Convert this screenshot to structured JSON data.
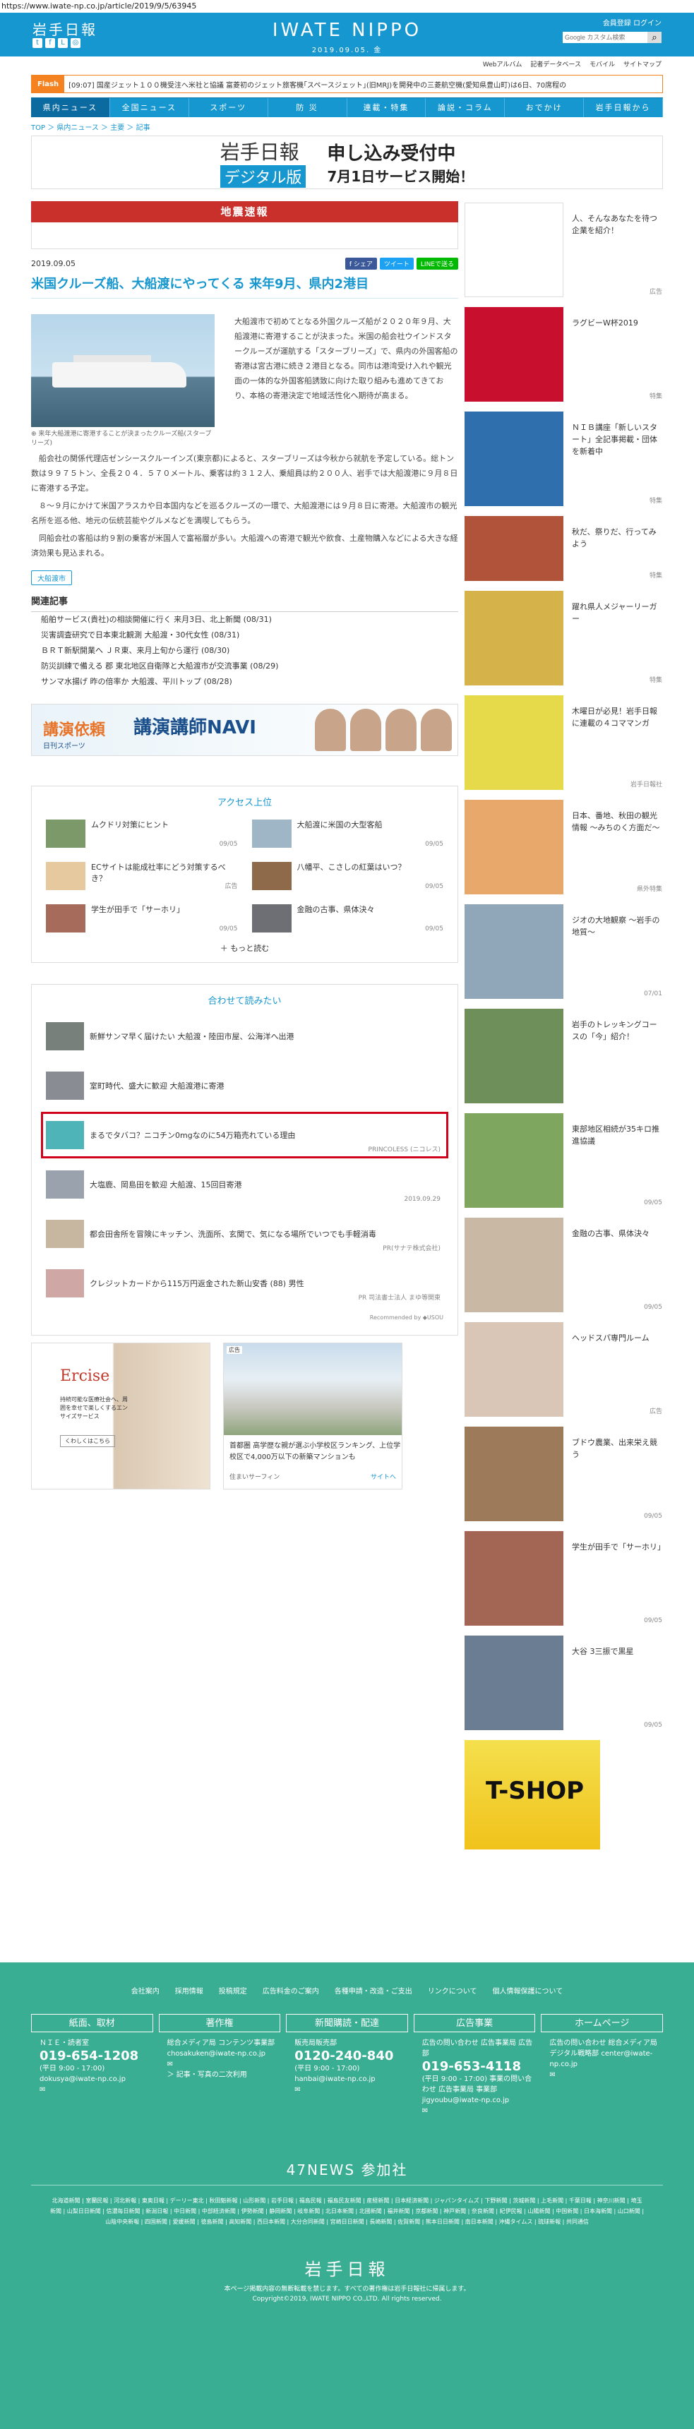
{
  "browser": {
    "url": "https://www.iwate-np.co.jp/article/2019/9/5/63945"
  },
  "header": {
    "logo_small": "岩手日報",
    "brand": "IWATE NIPPO",
    "date": "2019.09.05. 金",
    "login": "会員登録  ログイン",
    "search_placeholder": "Google カスタム検索",
    "subnav": [
      "Webアルバム",
      "記者データベース",
      "モバイル",
      "サイトマップ"
    ]
  },
  "flash": {
    "tag": "Flash",
    "text": "[09:07] 国産ジェット１００機受注へ米社と協議  富菱初のジェット旅客機｢スペースジェット｣(旧MRJ)を開発中の三菱航空機(愛知県豊山町)は6日、70席程の"
  },
  "nav": [
    "県内ニュース",
    "全国ニュース",
    "スポーツ",
    "防 災",
    "連載・特集",
    "論説・コラム",
    "おでかけ",
    "岩手日報から"
  ],
  "breadcrumb": "TOP ＞ 県内ニュース ＞ 主要 ＞ 記事",
  "banner": {
    "line1": "岩手日報",
    "line2": "デジタル版",
    "line3": "申し込み受付中",
    "line4": "7月1日サービス開始！"
  },
  "quake": {
    "title": "地震速報"
  },
  "article": {
    "date": "2019.09.05",
    "share": [
      "f シェア",
      "ツイート",
      "LINEで送る"
    ],
    "title": "米国クルーズ船、大船渡にやってくる  来年9月、県内2港目",
    "caption": "来年大船渡港に寄港することが決まったクルーズ船(スターブリーズ)",
    "p1": "大船渡市で初めてとなる外国クルーズ船が２０２０年９月、大船渡港に寄港することが決まった。米国の船会社ウインドスタークルーズが運航する「スターブリーズ」で、県内の外国客船の寄港は宮古港に続き２港目となる。同市は港湾受け入れや観光面の一体的な外国客船誘致に向けた取り組みも進めてきており、本格の寄港決定で地域活性化へ期待が高まる。",
    "p2": "船会社の関係代理店ゼンシースクルーインズ(東京都)によると、スターブリーズは今秋から就航を予定している。総トン数は９９７５トン、全長２０４．５７０メートル、乗客は約３１２人、乗組員は約２００人、岩手では大船渡港に９月８日に寄港する予定。",
    "p3": "８～９月にかけて米国アラスカや日本国内などを巡るクルーズの一環で、大船渡港には９月８日に寄港。大船渡市の観光名所を巡る他、地元の伝統芸能やグルメなどを満喫してもらう。",
    "p4": "同船会社の客船は約９割の乗客が米国人で富裕層が多い。大船渡への寄港で観光や飲食、土産物購入などによる大きな経済効果も見込まれる。",
    "tag": "大船渡市"
  },
  "related": {
    "title": "関連記事",
    "items": [
      "船舶サービス(貴社)の相談開催に行く  来月3日、北上新聞 (08/31)",
      "災害調査研究で日本東北観測  大船渡・30代女性 (08/31)",
      "ＢＲＴ新駅開業へ  ＪＲ東、来月上旬から運行 (08/30)",
      "防災訓練で備える  郡  東北地区自衛隊と大船渡市が交流事業 (08/29)",
      "サンマ水揚げ 昨の倍率か  大船渡、平川トップ (08/28)"
    ]
  },
  "ad2": {
    "t1": "講演依頼",
    "t2": "講演講師NAVI",
    "sub": "日刊スポーツ",
    "btn": "詳しくはこちら ▶"
  },
  "access": {
    "title": "アクセス上位",
    "items": [
      {
        "text": "ムクドリ対策にヒント",
        "date": "09/05"
      },
      {
        "text": "大船渡に米国の大型客船",
        "date": "09/05"
      },
      {
        "text": "ECサイトは能成社率にどう対策するべき？",
        "date": "広告"
      },
      {
        "text": "八幡平、こさしの紅葉はいつ？",
        "date": "09/05"
      },
      {
        "text": "学生が田手で「サーホリ」",
        "date": "09/05"
      },
      {
        "text": "金融の古事、県体決々",
        "date": "09/05"
      }
    ],
    "more": "＋ もっと読む"
  },
  "recommend": {
    "title": "合わせて読みたい",
    "items": [
      {
        "text": "新鮮サンマ早く届けたい  大船渡・陸田市屋、公海洋へ出港",
        "src": ""
      },
      {
        "text": "室町時代、盛大に歓迎  大船渡港に寄港",
        "src": ""
      },
      {
        "text": "まるでタバコ？ニコチン0mgなのに54万箱売れている理由",
        "src": "PRINCOLESS (ニコレス)"
      },
      {
        "text": "大塩鹿、岡島田を歓迎  大船渡、15回目寄港",
        "src": "2019.09.29"
      },
      {
        "text": "都会田舎所を冒険にキッチン、洗面所、玄関で、気になる場所でいつでも手軽消毒",
        "src": "PR(サナテ株式会社)"
      },
      {
        "text": "クレジットカードから115万円返金された新山安香 (88) 男性",
        "src": "PR 司法書士法人 まゆ等関東"
      }
    ],
    "powered": "Recommended by ◆USOU"
  },
  "ads3": {
    "a1_title": "Ercise",
    "a1_sub": "持続可能な医療社会へ、周囲を幸せで楽しくするエンサイズサービス",
    "a1_btn": "くわしくはこちら",
    "a2_label": "広告",
    "a2_title": "首都圏 高学歴な親が選ぶ小学校区ランキング、上位学校区で4,000万以下の新築マンションも",
    "a2_src": "住まいサーフィン",
    "a2_url": "サイトへ"
  },
  "side": [
    {
      "text": "人、そんなあなたを待つ企業を紹介！",
      "date": "広告"
    },
    {
      "text": "ラグビーW杯2019",
      "date": "特集"
    },
    {
      "text": "ＮＩＢ講座「新しいスタート」全記事掲載・団体を新着中",
      "date": "特集"
    },
    {
      "text": "秋だ、祭りだ、行ってみよう",
      "date": "特集"
    },
    {
      "text": "躍れ県人メジャーリーガー",
      "date": "特集"
    },
    {
      "text": "木曜日が必見！岩手日報に連載の４コママンガ",
      "date": "岩手日報社"
    },
    {
      "text": "日本、番地、秋田の観光情報 ～みちのく方面だ～",
      "date": "県外特集"
    },
    {
      "text": "ジオの大地観察 ～岩手の地質～",
      "date": "07/01"
    },
    {
      "text": "岩手のトレッキングコースの「今」紹介！",
      "date": ""
    },
    {
      "text": "東部地区相続が35キロ推進協議",
      "date": "09/05"
    },
    {
      "text": "金融の古事、県体決々",
      "date": "09/05"
    },
    {
      "text": "ヘッドスパ専門ルーム",
      "date": "広告"
    },
    {
      "text": "ブドウ農業、出来栄え競う",
      "date": "09/05"
    },
    {
      "text": "学生が田手で「サーホリ」",
      "date": "09/05"
    },
    {
      "text": "大谷 3三振で黒星",
      "date": "09/05"
    }
  ],
  "side_ad": {
    "text": "T-SHOP"
  },
  "footer": {
    "links": [
      "会社案内",
      "採用情報",
      "投稿規定",
      "広告料金のご案内",
      "各種申請・改造・ご支出",
      "リンクについて",
      "個人情報保護について"
    ],
    "cols": [
      {
        "h": "紙面、取材",
        "p": "ＮＩＥ・読者室",
        "tel": "019-654-1208",
        "p2": "(平日 9:00 - 17:00)  dokusya@iwate-np.co.jp"
      },
      {
        "h": "著作権",
        "p": "総合メディア局 コンテンツ事業部 chosakuken@iwate-np.co.jp",
        "tel": "",
        "p2": "＞ 記事・写真の二次利用"
      },
      {
        "h": "新聞購読・配達",
        "p": "販売局販売部",
        "tel": "0120-240-840",
        "p2": "(平日 9:00 - 17:00) hanbai@iwate-np.co.jp"
      },
      {
        "h": "広告事業",
        "p": "広告の問い合わせ 広告事業局 広告部",
        "tel": "019-653-4118",
        "p2": "(平日 9:00 - 17:00) 事業の問い合わせ 広告事業局 事業部 jigyoubu@iwate-np.co.jp"
      },
      {
        "h": "ホームページ",
        "p": "広告の問い合わせ 総合メディア局 デジタル戦略部 center@iwate-np.co.jp",
        "tel": "",
        "p2": ""
      }
    ],
    "n47": "47NEWS 参加社",
    "partners": "北海道新聞 | 室蘭民報 | 河北新報 | 東奥日報 | デーリー東北 | 秋田魁新報 | 山形新聞 | 岩手日報 | 福島民報 | 福島民友新聞 | 産経新聞 | 日本経済新聞 | ジャパンタイムズ | 下野新聞 | 茨城新聞 | 上毛新聞 | 千葉日報 | 神奈川新聞 | 埼玉新聞 | 山梨日日新聞 | 信濃毎日新聞 | 新潟日報 | 中日新聞 | 中部経済新聞 | 伊勢新聞 | 静岡新聞 | 岐阜新聞 | 北日本新聞 | 北國新聞 | 福井新聞 | 京都新聞 | 神戸新聞 | 奈良新聞 | 紀伊民報 | 山陽新聞 | 中国新聞 | 日本海新聞 | 山口新聞 | 山陰中央新報 | 四国新聞 | 愛媛新聞 | 徳島新聞 | 高知新聞 | 西日本新聞 | 大分合同新聞 | 宮崎日日新聞 | 長崎新聞 | 佐賀新聞 | 熊本日日新聞 | 南日本新聞 | 沖縄タイムス | 琉球新報 | 共同通信",
    "logo": "岩手日報",
    "notice": "本ページ掲載内容の無断転載を禁じます。すべての著作権は岩手日報社に帰属します。",
    "copy": "Copyright©2019, IWATE NIPPO CO.,LTD. All rights reserved."
  },
  "colors": {
    "brand": "#1797cf",
    "footer": "#3aae93",
    "alert": "#c9302c",
    "flash": "#f58220"
  }
}
